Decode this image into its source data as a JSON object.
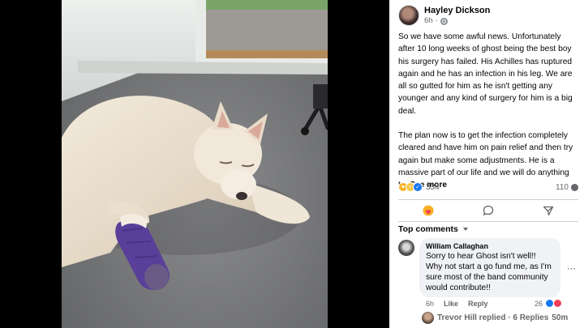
{
  "post": {
    "author": "Hayley Dickson",
    "time": "6h",
    "privacy_icon": "globe-icon",
    "paragraph_1": "So we have some awful news. Unfortunately after 10 long weeks of ghost being the best boy his surgery has failed. His Achilles has ruptured again and he has an infection in his leg. We are all so gutted for him as he isn't getting any younger and any kind of surgery for him is a big deal.",
    "paragraph_2": "The plan now is to get the infection completely cleared and have him on pain relief and then try again but make some adjustments. He is a massive part of our life and we will do anything t...",
    "see_more": "See more"
  },
  "reactions": {
    "count": "334",
    "comment_count": "110",
    "icons": [
      "care-icon",
      "sad-icon",
      "like-icon"
    ]
  },
  "actions": {
    "icons": [
      "care-react-icon",
      "comment-icon",
      "share-icon"
    ]
  },
  "comments": {
    "sort_label": "Top comments",
    "first": {
      "author": "William Callaghan",
      "text": "Sorry to hear Ghost isn't well!! Why not start a go fund me, as I'm sure most of the band community would contribute!!",
      "time": "6h",
      "like_label": "Like",
      "reply_label": "Reply",
      "reaction_count": "26"
    },
    "replies": {
      "text": "Trevor Hill replied · 6 Replies",
      "time": "50m"
    }
  },
  "colors": {
    "link_blue": "#1877f2",
    "secondary_text": "#65676b",
    "bubble_bg": "#f0f2f5"
  }
}
